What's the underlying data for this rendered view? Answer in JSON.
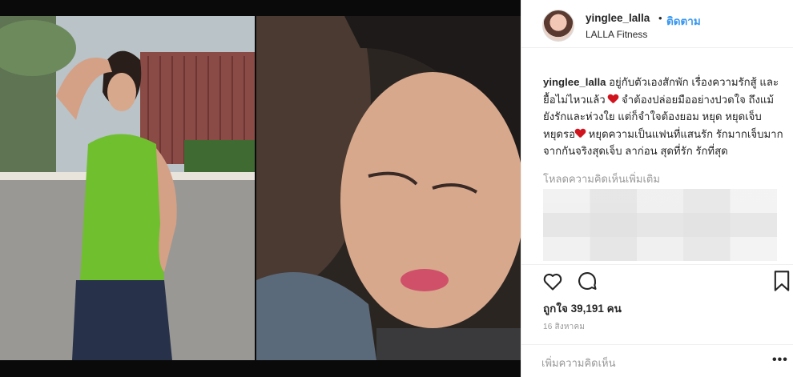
{
  "post": {
    "username": "yinglee_lalla",
    "separator": "•",
    "follow_label": "ติดตาม",
    "location": "LALLA Fitness",
    "caption": {
      "user": "yinglee_lalla",
      "part1": "อยู่กับตัวเองสักพัก เรื่องความรักสู้ และยื้อไม่ไหวแล้ว",
      "part2": "จำต้องปล่อยมืออย่างปวดใจ ถึงแม้ยังรักและห่วงใย แต่ก็จำใจต้องยอม หยุด หยุดเจ็บ หยุดรอ",
      "part3": "หยุดความเป็นแฟนที่แสนรัก รักมากเจ็บมาก จากกันจริงสุดเจ็บ ลาก่อน สุดที่รัก รักที่สุด"
    },
    "load_more_comments": "โหลดความคิดเห็นเพิ่มเติม",
    "likes_text": "ถูกใจ 39,191 คน",
    "timestamp": "16 สิงหาคม",
    "comment_placeholder": "เพิ่มความคิดเห็น",
    "more_options": "•••"
  },
  "icons": {
    "like": "heart-outline-icon",
    "comment": "speech-bubble-icon",
    "bookmark": "bookmark-icon",
    "caption_emoji": "red-heart-icon"
  },
  "colors": {
    "follow": "#3897f0",
    "heart_emoji": "#d0141e",
    "muted_text": "#999999",
    "media_background": "#0a0a0a"
  }
}
